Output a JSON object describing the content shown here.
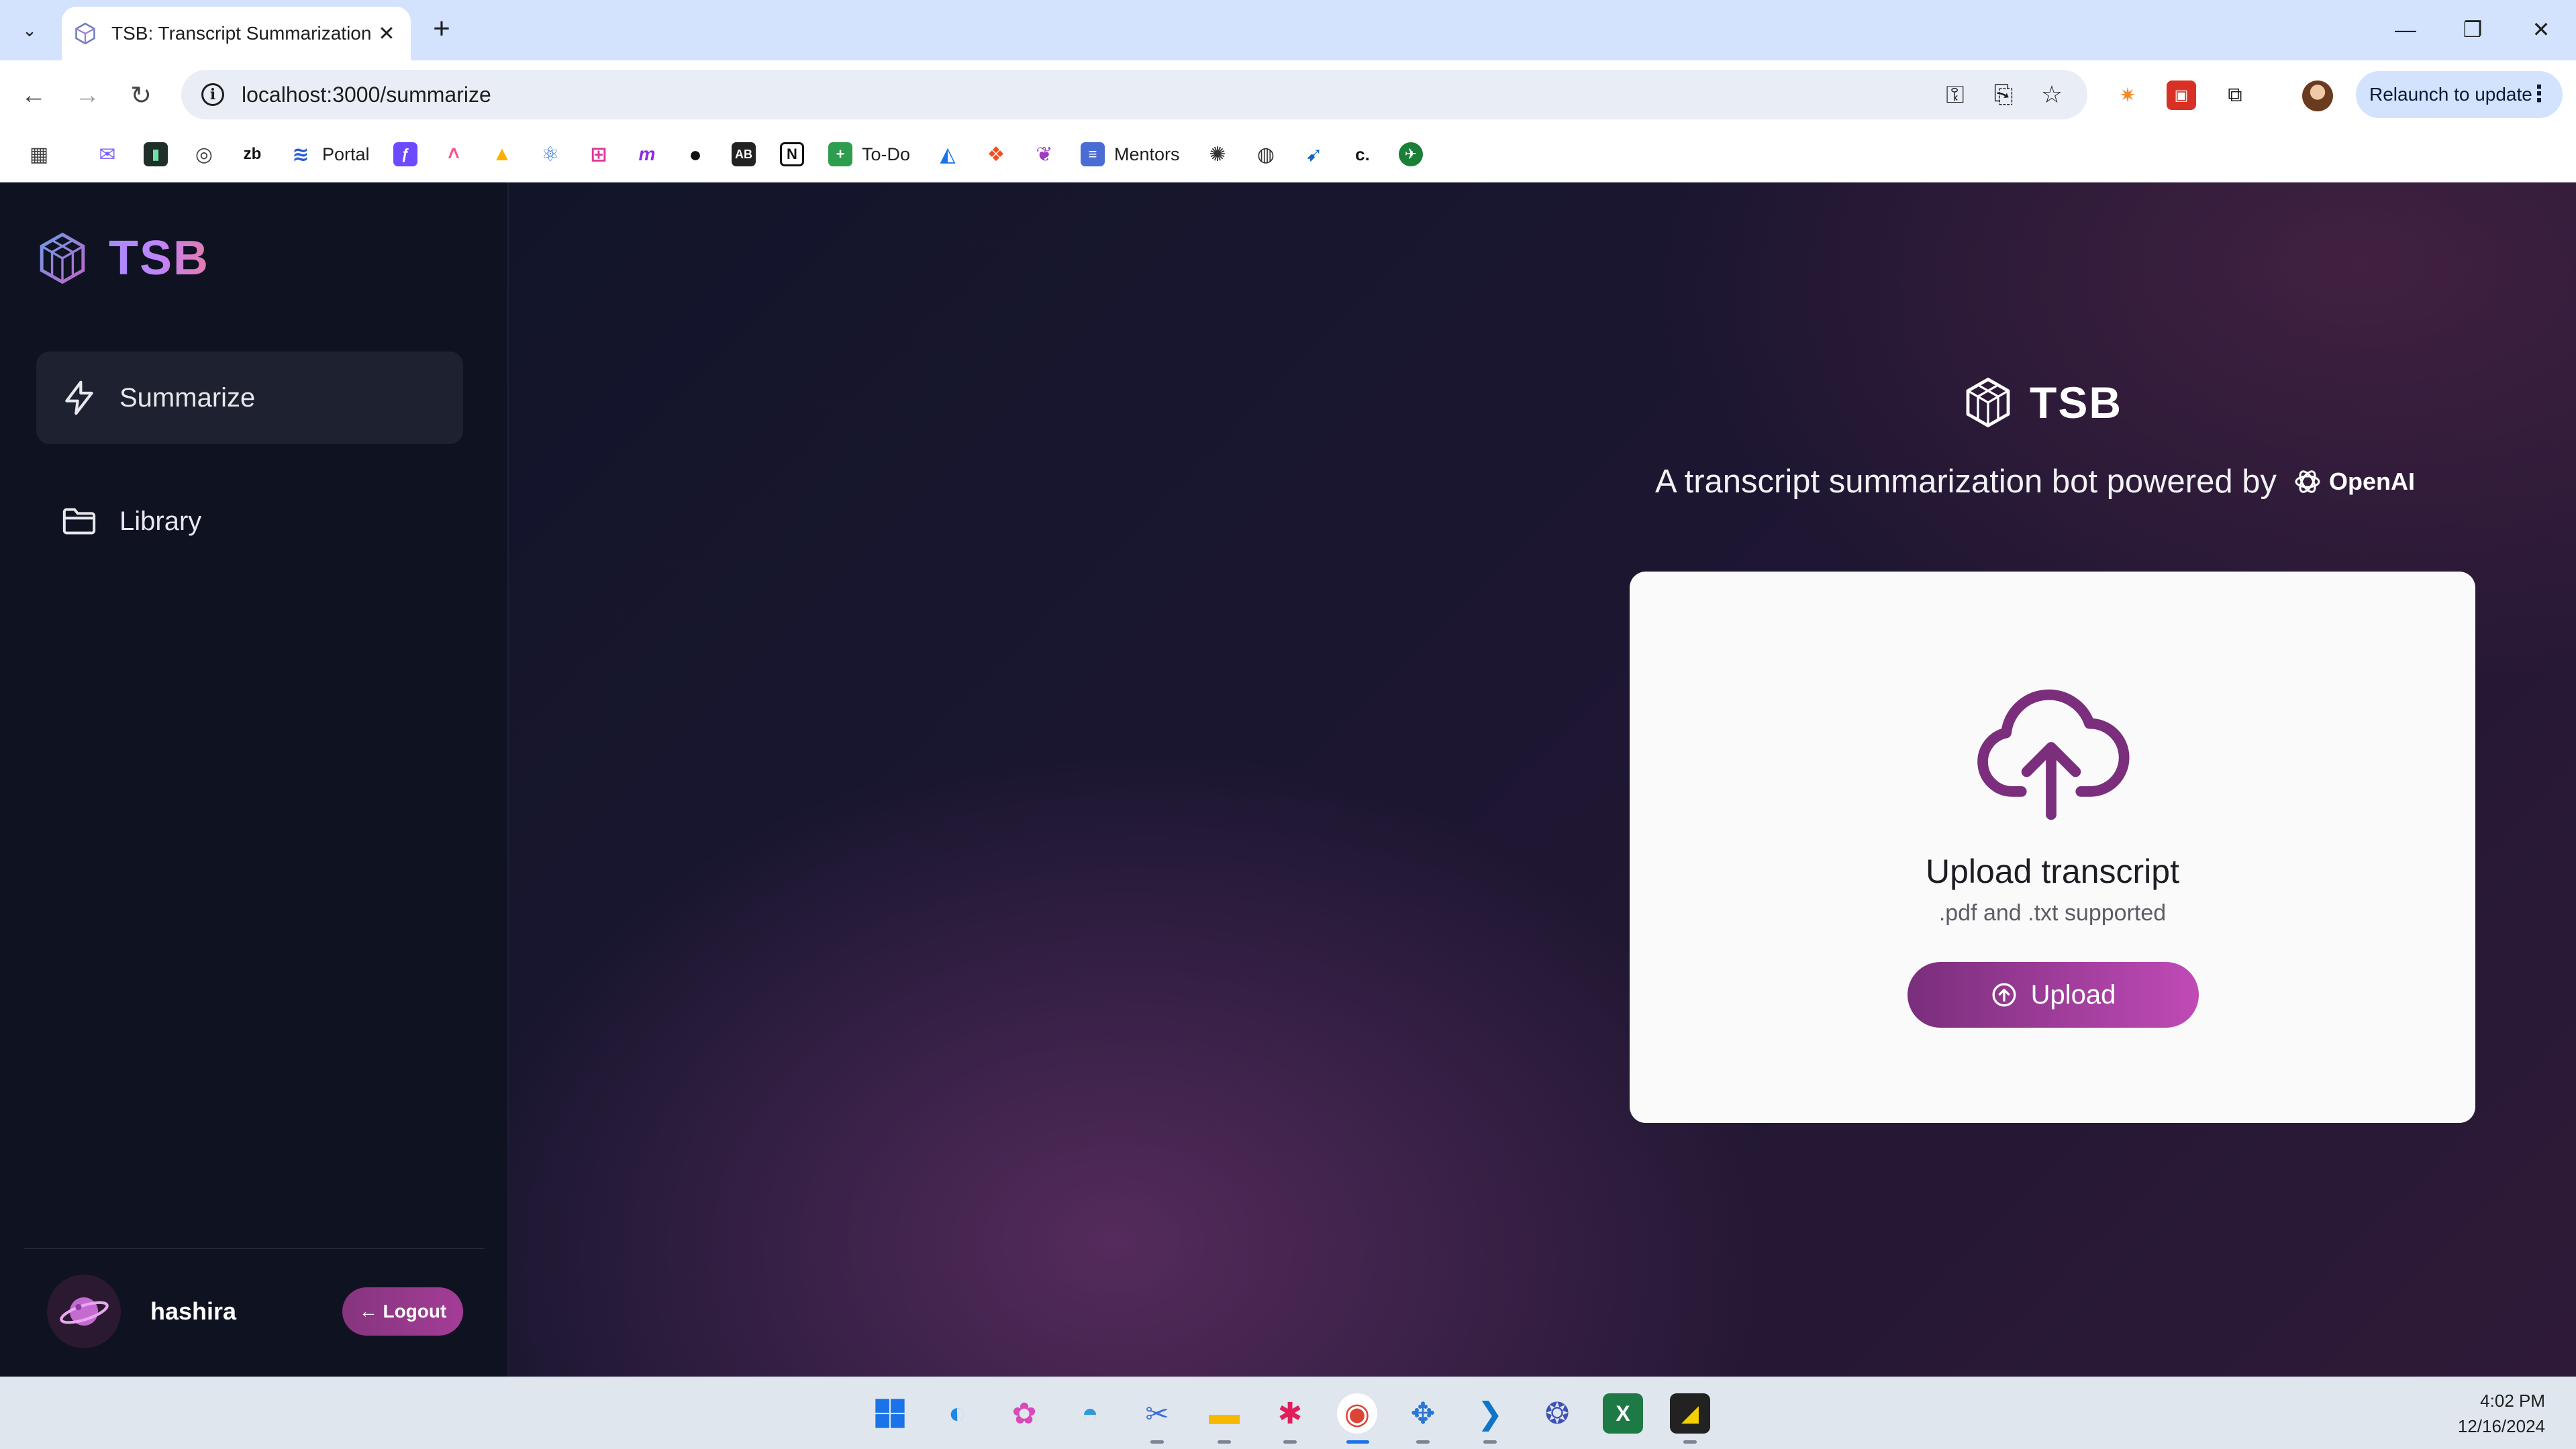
{
  "browser": {
    "tab_title": "TSB: Transcript Summarization B",
    "new_tab_symbol": "+",
    "url": "localhost:3000/summarize",
    "relaunch_label": "Relaunch to update",
    "bookmarks": [
      {
        "label": "Portal"
      },
      {
        "label": "To-Do"
      },
      {
        "label": "Mentors"
      }
    ]
  },
  "sidebar": {
    "brand": "TSB",
    "items": [
      {
        "label": "Summarize",
        "icon": "bolt-icon",
        "active": true
      },
      {
        "label": "Library",
        "icon": "folder-icon",
        "active": false
      }
    ],
    "user": {
      "name": "hashira"
    },
    "logout_label": "← Logout"
  },
  "main": {
    "brand": "TSB",
    "tagline": "A transcript summarization bot powered by",
    "provider": "OpenAI",
    "upload_card": {
      "title": "Upload transcript",
      "subtitle": ".pdf and .txt supported",
      "button_label": "Upload"
    }
  },
  "taskbar": {
    "time": "4:02 PM",
    "date": "12/16/2024"
  },
  "colors": {
    "accent": "#a43c96",
    "sidebar_bg": "#0f1220",
    "card_bg": "#fafafa",
    "cloud_stroke": "#7a2e7c"
  }
}
